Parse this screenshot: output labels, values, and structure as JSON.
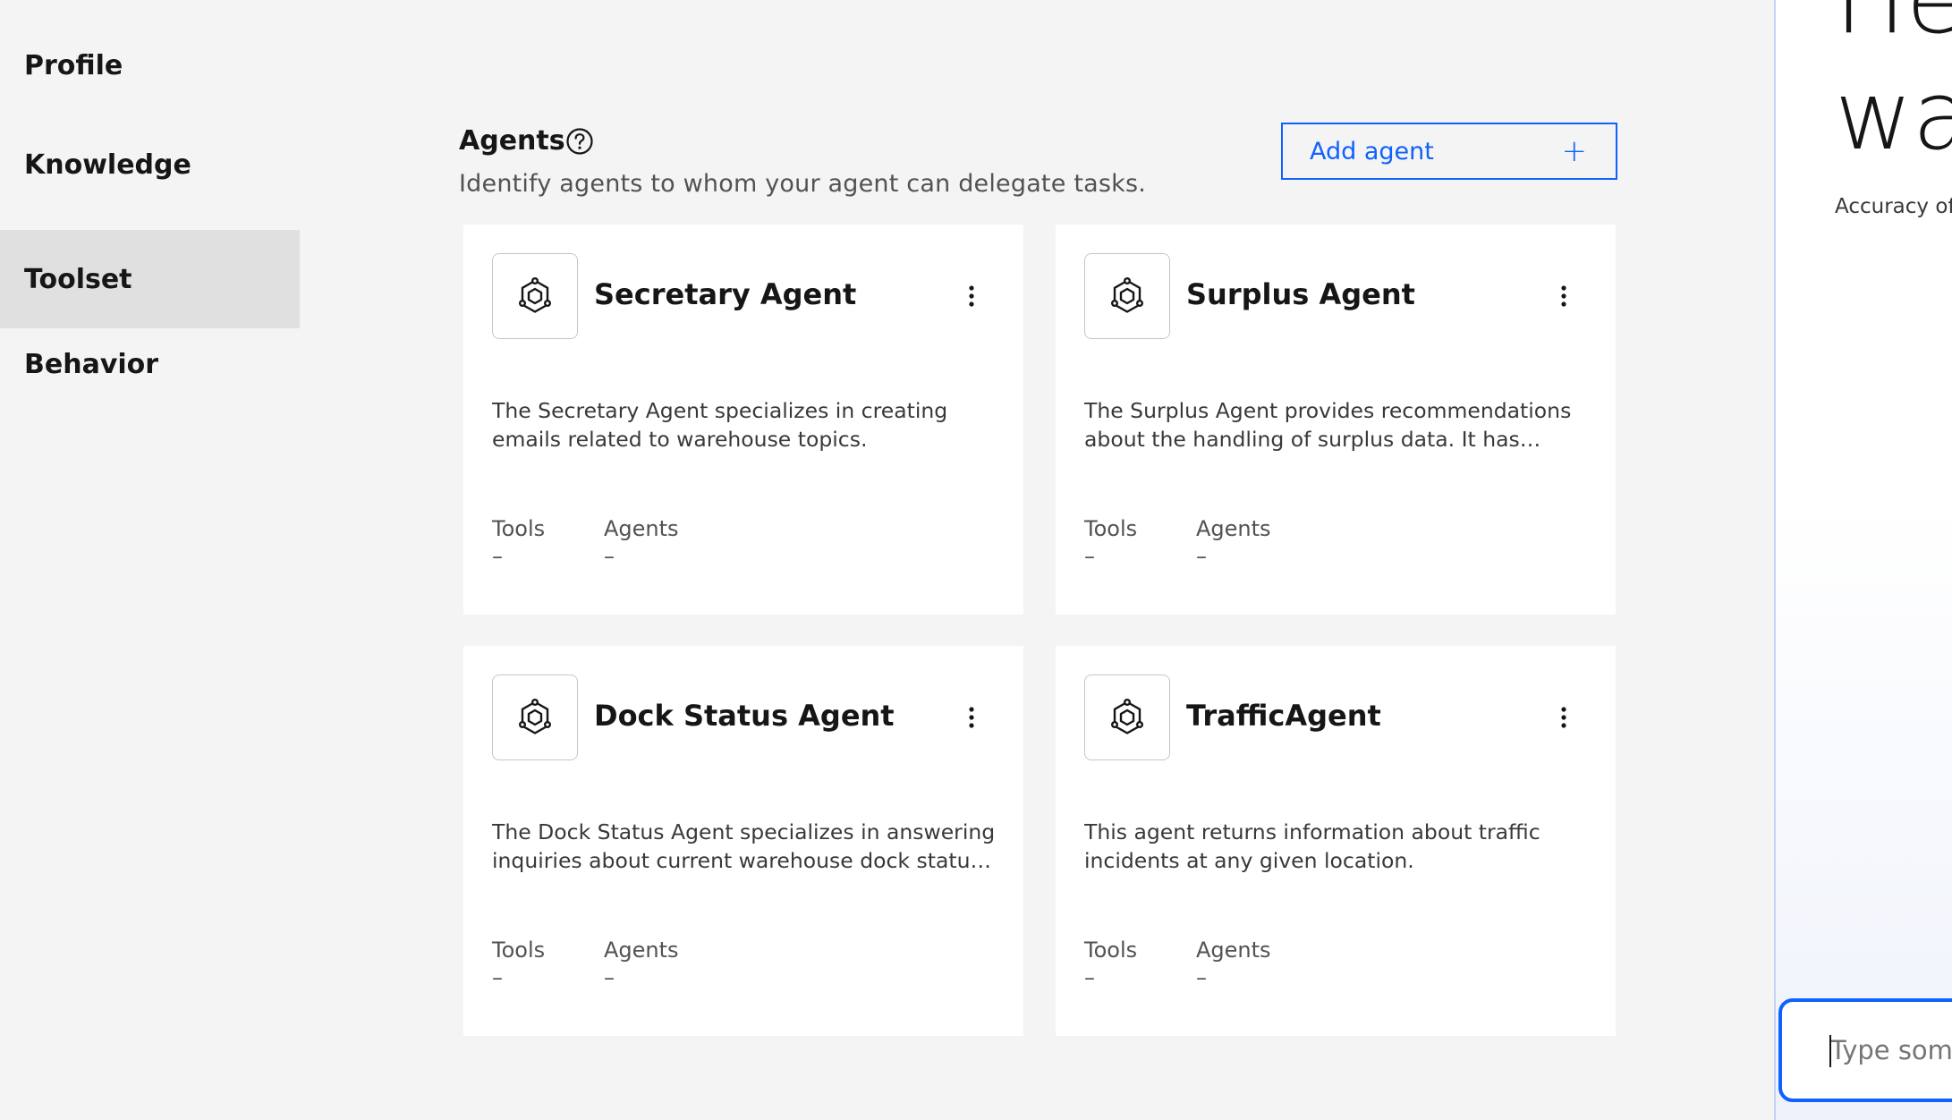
{
  "sidebar": {
    "items": [
      {
        "label": "Profile"
      },
      {
        "label": "Knowledge"
      },
      {
        "label": "Toolset",
        "active": true
      },
      {
        "label": "Behavior"
      }
    ]
  },
  "agents_section": {
    "title": "Agents",
    "help_icon": "help-circle-icon",
    "subtitle": "Identify agents to whom your agent can delegate tasks.",
    "add_button_label": "Add agent",
    "add_button_icon": "+"
  },
  "cards": [
    {
      "title": "Secretary Agent",
      "description": "The Secretary Agent specializes in creating emails related to warehouse topics.",
      "tools_label": "Tools",
      "tools_value": "–",
      "agents_label": "Agents",
      "agents_value": "–"
    },
    {
      "title": "Surplus Agent",
      "description": "The Surplus Agent provides recommendations about the handling of surplus data. It has acces...",
      "tools_label": "Tools",
      "tools_value": "–",
      "agents_label": "Agents",
      "agents_value": "–"
    },
    {
      "title": "Dock Status Agent",
      "description": "The Dock Status Agent specializes in answering inquiries about current warehouse dock status. ...",
      "tools_label": "Tools",
      "tools_value": "–",
      "agents_label": "Agents",
      "agents_value": "–"
    },
    {
      "title": "TrafficAgent",
      "description": "This agent returns information about traffic incidents at any given location.",
      "tools_label": "Tools",
      "tools_value": "–",
      "agents_label": "Agents",
      "agents_value": "–"
    }
  ],
  "right_panel": {
    "heading_line1": "He",
    "heading_line2": "wa",
    "accuracy_text": "Accuracy of",
    "chat_placeholder": "Type some"
  },
  "colors": {
    "accent": "#0f62fe",
    "page_bg": "#f4f4f4",
    "card_bg": "#ffffff",
    "active_nav_bg": "#e0e0e0"
  }
}
